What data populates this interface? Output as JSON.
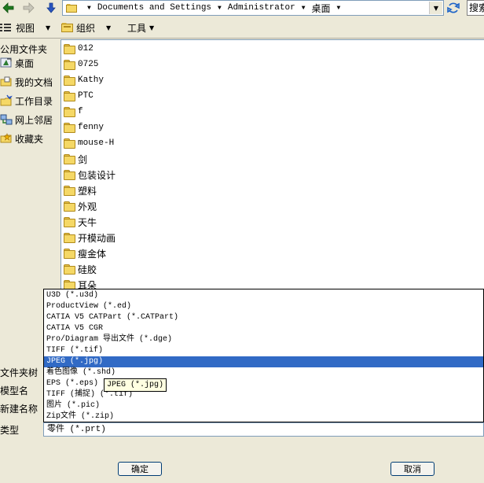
{
  "address_bar": {
    "path": [
      "Documents and Settings",
      "Administrator",
      "桌面"
    ],
    "search_label": "搜索"
  },
  "toolbar": {
    "view_label": "视图",
    "organize_label": "组织",
    "tools_label": "工具"
  },
  "left_pane": {
    "header": "公用文件夹",
    "items": [
      {
        "label": "桌面",
        "icon": "desktop-icon"
      },
      {
        "label": "我的文档",
        "icon": "my-documents-icon"
      },
      {
        "label": "工作目录",
        "icon": "working-directory-icon"
      },
      {
        "label": "网上邻居",
        "icon": "network-icon"
      },
      {
        "label": "收藏夹",
        "icon": "favorites-icon"
      }
    ]
  },
  "folders": [
    "012",
    "0725",
    "Kathy",
    "PTC",
    "f",
    "fenny",
    "mouse-H",
    "剑",
    "包装设计",
    "塑料",
    "外观",
    "天牛",
    "开模动画",
    "瘦金体",
    "硅胶",
    "耳朵"
  ],
  "bottom_labels": {
    "folder_tree": "文件夹树",
    "model_name": "模型名",
    "new_name": "新建名称",
    "type": "类型"
  },
  "type_dropdown": {
    "options": [
      "U3D (*.u3d)",
      "ProductView (*.ed)",
      "CATIA V5 CATPart (*.CATPart)",
      "CATIA V5 CGR",
      "Pro/Diagram 导出文件 (*.dge)",
      "TIFF (*.tif)",
      "JPEG (*.jpg)",
      "着色图像 (*.shd)",
      "EPS (*.eps)",
      "TIFF (捕捉) (*.tif)",
      "图片 (*.pic)",
      "Zip文件 (*.zip)"
    ],
    "selected_index": 6,
    "tooltip": "JPEG (*.jpg)",
    "current_value": "零件 (*.prt)"
  },
  "buttons": {
    "ok": "确定",
    "cancel": "取消"
  },
  "colors": {
    "selection": "#316ac5",
    "dialog_bg": "#ece9d8",
    "tooltip_bg": "#ffffe1"
  }
}
